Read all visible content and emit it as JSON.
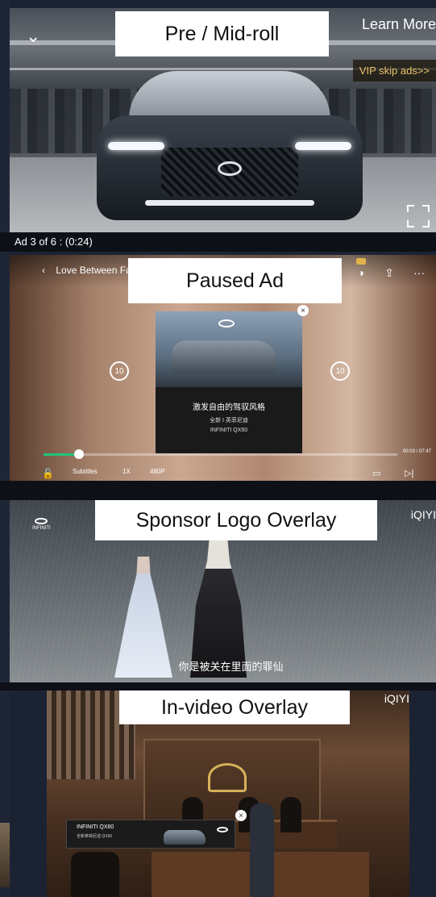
{
  "colors": {
    "label_bg": "#ffffff",
    "vip_text": "#e8c16a",
    "progress": "#22c37a"
  },
  "panels": [
    {
      "label": "Pre / Mid-roll"
    },
    {
      "label": "Paused Ad"
    },
    {
      "label": "Sponsor Logo Overlay"
    },
    {
      "label": "In-video Overlay"
    }
  ],
  "preroll": {
    "learn_more": "Learn More",
    "vip_skip": "VIP skip ads>>",
    "ad_counter": "Ad 3 of 6 : (0:24)",
    "back_icon": "chevron-down-icon",
    "fullscreen_icon": "fullscreen-icon"
  },
  "paused": {
    "title": "Love Between Fairy",
    "skip_back": "10",
    "skip_forward": "10",
    "time": "00:03 / 07:47",
    "progress": 0.1,
    "controls": {
      "subtitles": "Subtitles",
      "speed": "1X",
      "quality": "480P"
    },
    "ad": {
      "model": "INFINITI QX60",
      "line1": "激发自由的驾驭风格",
      "line2": "全新 I 英菲尼迪",
      "line3": "INFINITI QX60"
    }
  },
  "sponsor": {
    "logo_text": "INFINITI",
    "brand": "iQIYI",
    "subtitle": "你是被关在里面的罪仙"
  },
  "invideo": {
    "brand": "iQIYI",
    "overlay_title": "INFINITI QX60",
    "overlay_sub": "全新英菲尼迪 QX60"
  }
}
